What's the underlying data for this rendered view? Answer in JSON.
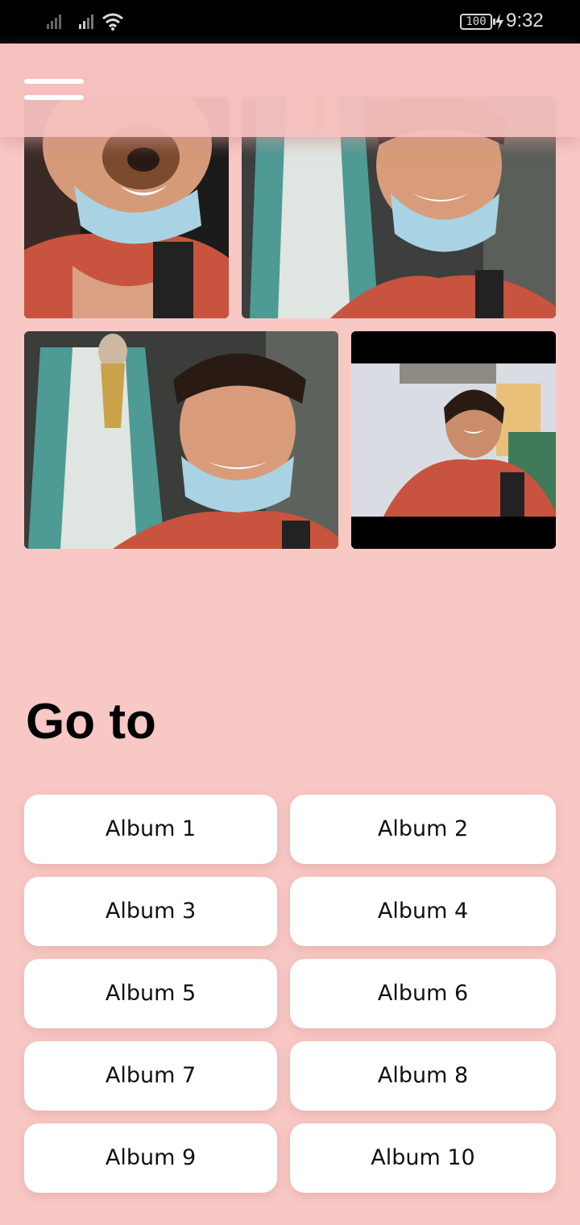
{
  "status_bar": {
    "battery": "100",
    "time": "9:32"
  },
  "header": {
    "menu_icon": "hamburger-menu-icon"
  },
  "gallery": {
    "photos": [
      {
        "name": "photo-selfie-dog-filter"
      },
      {
        "name": "photo-selfie-with-statue"
      },
      {
        "name": "photo-selfie-with-statue-2"
      },
      {
        "name": "photo-selfie-indoor"
      }
    ]
  },
  "goto": {
    "title": "Go to",
    "albums": [
      "Album 1",
      "Album 2",
      "Album 3",
      "Album 4",
      "Album 5",
      "Album 6",
      "Album 7",
      "Album 8",
      "Album 9",
      "Album 10"
    ]
  },
  "colors": {
    "background": "#f8c8c5",
    "button": "#ffffff",
    "text": "#111111"
  }
}
